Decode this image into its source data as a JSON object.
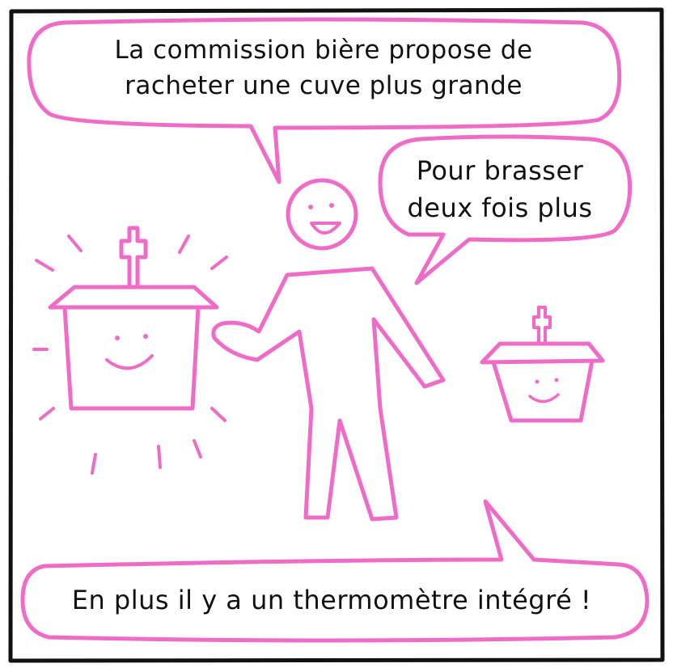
{
  "colors": {
    "frame": "#111111",
    "drawing": "#f06ac8",
    "text": "#111111",
    "background": "#ffffff"
  },
  "bubbles": {
    "top": {
      "line1": "La commission bière propose de",
      "line2": "racheter une cuve plus grande"
    },
    "right": {
      "line1": "Pour brasser",
      "line2": "deux fois plus"
    },
    "bottom": {
      "line1": "En plus il y a un thermomètre intégré !"
    }
  },
  "figures": {
    "person": "smiling-stick-person",
    "big_tank": "big-brewing-tank-smiling",
    "small_tank": "small-brewing-tank-smiling"
  }
}
